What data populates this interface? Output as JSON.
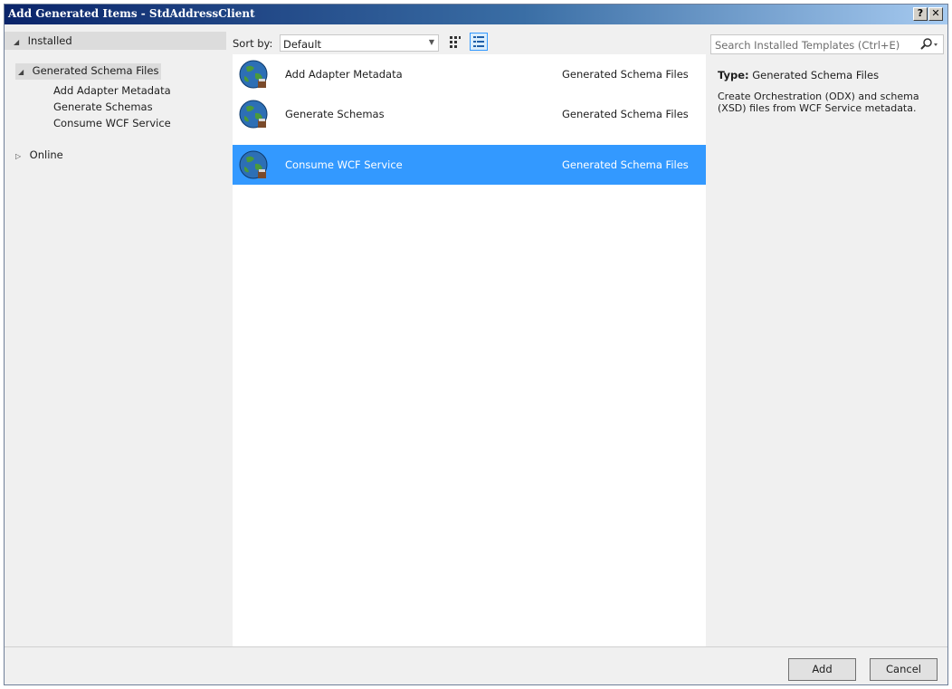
{
  "window": {
    "title": "Add Generated Items - StdAddressClient",
    "help_glyph": "?",
    "close_glyph": "✕"
  },
  "left": {
    "installed_label": "Installed",
    "tree": {
      "category_label": "Generated Schema Files",
      "children": [
        "Add Adapter Metadata",
        "Generate Schemas",
        "Consume WCF Service"
      ]
    },
    "online_label": "Online"
  },
  "toolbar": {
    "sort_label": "Sort by:",
    "sort_value": "Default",
    "views": [
      "grid-view-icon",
      "list-view-icon"
    ],
    "active_view": "list"
  },
  "templates": [
    {
      "name": "Add Adapter Metadata",
      "category": "Generated Schema Files",
      "selected": false
    },
    {
      "name": "Generate Schemas",
      "category": "Generated Schema Files",
      "selected": false
    },
    {
      "name": "Consume WCF Service",
      "category": "Generated Schema Files",
      "selected": true
    }
  ],
  "details": {
    "search_placeholder": "Search Installed Templates (Ctrl+E)",
    "type_label": "Type:",
    "type_value": "Generated Schema Files",
    "description": "Create Orchestration (ODX) and schema (XSD) files from WCF Service metadata."
  },
  "buttons": {
    "add": "Add",
    "cancel": "Cancel"
  },
  "colors": {
    "selection": "#3399ff",
    "titlebar_start": "#0a246a",
    "titlebar_end": "#a6caf0"
  }
}
